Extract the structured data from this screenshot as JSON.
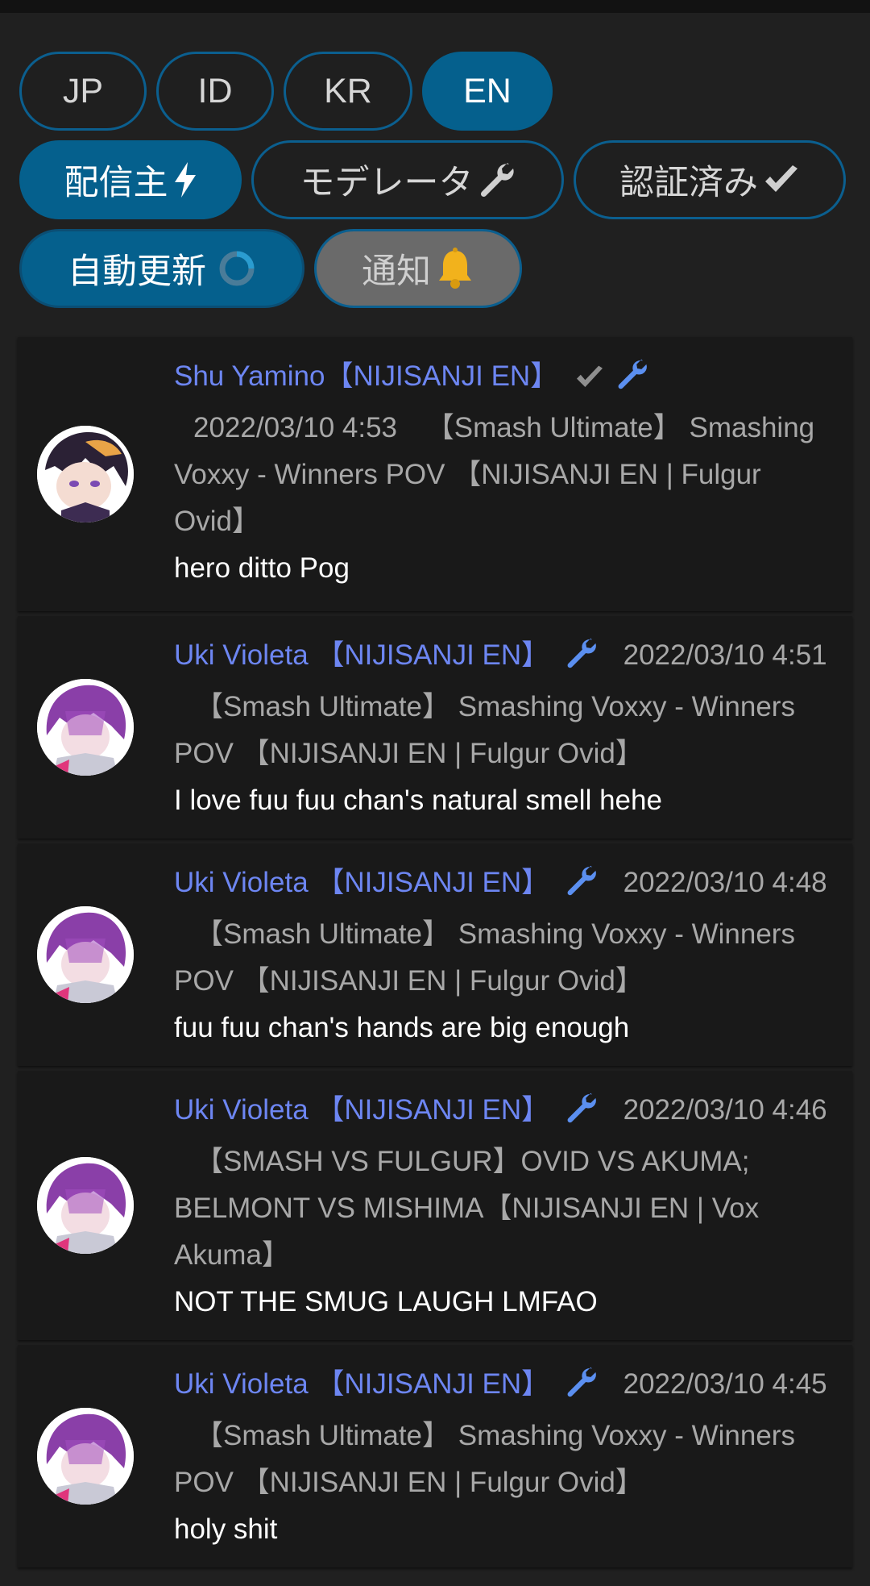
{
  "filters": {
    "lang": [
      {
        "label": "JP",
        "active": false
      },
      {
        "label": "ID",
        "active": false
      },
      {
        "label": "KR",
        "active": false
      },
      {
        "label": "EN",
        "active": true
      }
    ],
    "roles": {
      "streamer_label": "配信主",
      "moderator_label": "モデレータ",
      "verified_label": "認証済み"
    },
    "auto_refresh_label": "自動更新",
    "notify_label": "通知"
  },
  "colors": {
    "accent": "#05608d",
    "name": "#6d86f2",
    "meta": "#a8a8a8",
    "background": "#202020",
    "card": "#191919"
  },
  "messages": [
    {
      "author": "Shu Yamino【NIJISANJI EN】",
      "badges": [
        "check-icon",
        "wrench-icon"
      ],
      "timestamp": "2022/03/10 4:53",
      "stream": "【Smash Ultimate】 Smashing Voxxy - Winners POV 【NIJISANJI EN | Fulgur Ovid】",
      "text": "hero ditto Pog",
      "avatar": "shu"
    },
    {
      "author": "Uki Violeta 【NIJISANJI EN】",
      "badges": [
        "wrench-icon"
      ],
      "timestamp": "2022/03/10 4:51",
      "stream": "【Smash Ultimate】 Smashing Voxxy - Winners POV 【NIJISANJI EN | Fulgur Ovid】",
      "text": "I love fuu fuu chan's natural smell hehe",
      "avatar": "uki"
    },
    {
      "author": "Uki Violeta 【NIJISANJI EN】",
      "badges": [
        "wrench-icon"
      ],
      "timestamp": "2022/03/10 4:48",
      "stream": "【Smash Ultimate】 Smashing Voxxy - Winners POV 【NIJISANJI EN | Fulgur Ovid】",
      "text": "fuu fuu chan's hands are big enough",
      "avatar": "uki"
    },
    {
      "author": "Uki Violeta 【NIJISANJI EN】",
      "badges": [
        "wrench-icon"
      ],
      "timestamp": "2022/03/10 4:46",
      "stream": "【SMASH VS FULGUR】OVID VS AKUMA; BELMONT VS MISHIMA【NIJISANJI EN | Vox Akuma】",
      "text": "NOT THE SMUG LAUGH LMFAO",
      "avatar": "uki"
    },
    {
      "author": "Uki Violeta 【NIJISANJI EN】",
      "badges": [
        "wrench-icon"
      ],
      "timestamp": "2022/03/10 4:45",
      "stream": "【Smash Ultimate】 Smashing Voxxy - Winners POV 【NIJISANJI EN | Fulgur Ovid】",
      "text": "holy shit",
      "avatar": "uki"
    }
  ]
}
